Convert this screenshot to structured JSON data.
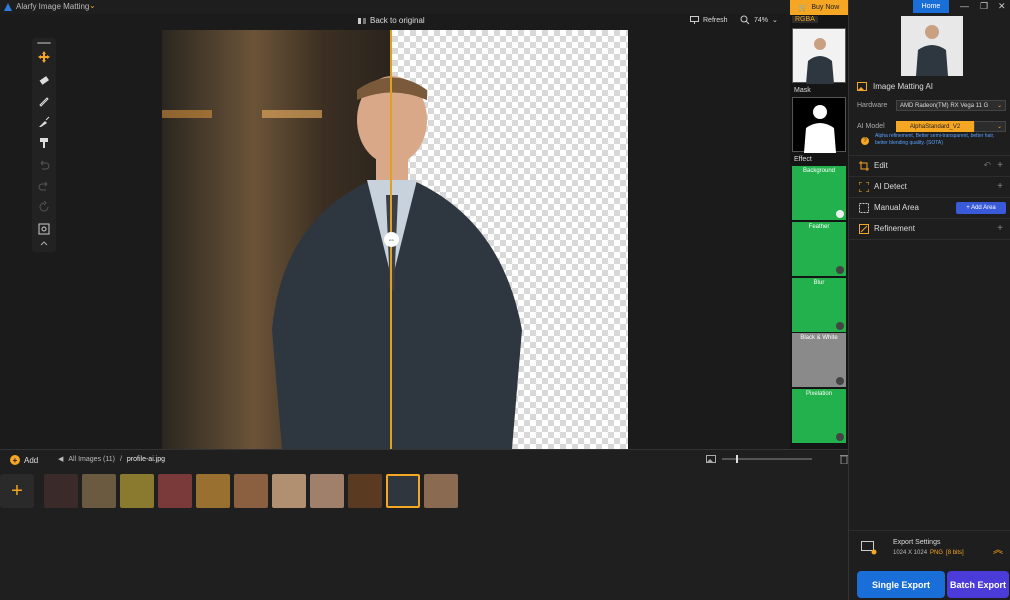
{
  "app": {
    "title": "Alarfy Image Matting"
  },
  "canvas_bar": {
    "back_original": "Back to original",
    "refresh": "Refresh",
    "zoom": "74%"
  },
  "bottom": {
    "add": "Add",
    "all_images": "All Images (11)",
    "separator": "/",
    "current_file": "profile-ai.jpg"
  },
  "effects": {
    "buy_now": "Buy Now",
    "rgba": "RGBA",
    "mask": "Mask",
    "effect_label": "Effect",
    "items": [
      {
        "label": "Background",
        "selected": true
      },
      {
        "label": "Feather",
        "selected": false
      },
      {
        "label": "Blur",
        "selected": false
      },
      {
        "label": "Black & White",
        "selected": false
      },
      {
        "label": "Pixelation",
        "selected": false
      }
    ]
  },
  "right": {
    "home": "Home",
    "panel_title": "Image Matting AI",
    "hardware_label": "Hardware",
    "hardware_value": "AMD Radeon(TM) RX Vega 11 G",
    "ai_model_label": "AI Model",
    "ai_model_value": "AlphaStandard_V2",
    "help_text": "Alpha refinement, Better semi-transparent, better hair, better blending quality. (SOTA)",
    "sections": {
      "edit": "Edit",
      "ai_detect": "AI Detect",
      "manual_area": "Manual Area",
      "add_area": "+ Add Area",
      "refinement": "Refinement"
    },
    "export": {
      "title": "Export Settings",
      "size": "1024 X 1024",
      "format": "PNG",
      "bits": "[8 bits]"
    },
    "single_export": "Single Export",
    "batch_export": "Batch Export"
  },
  "colors": {
    "accent": "#f5a623",
    "blue": "#1a6ed8",
    "green": "#22b14c"
  }
}
